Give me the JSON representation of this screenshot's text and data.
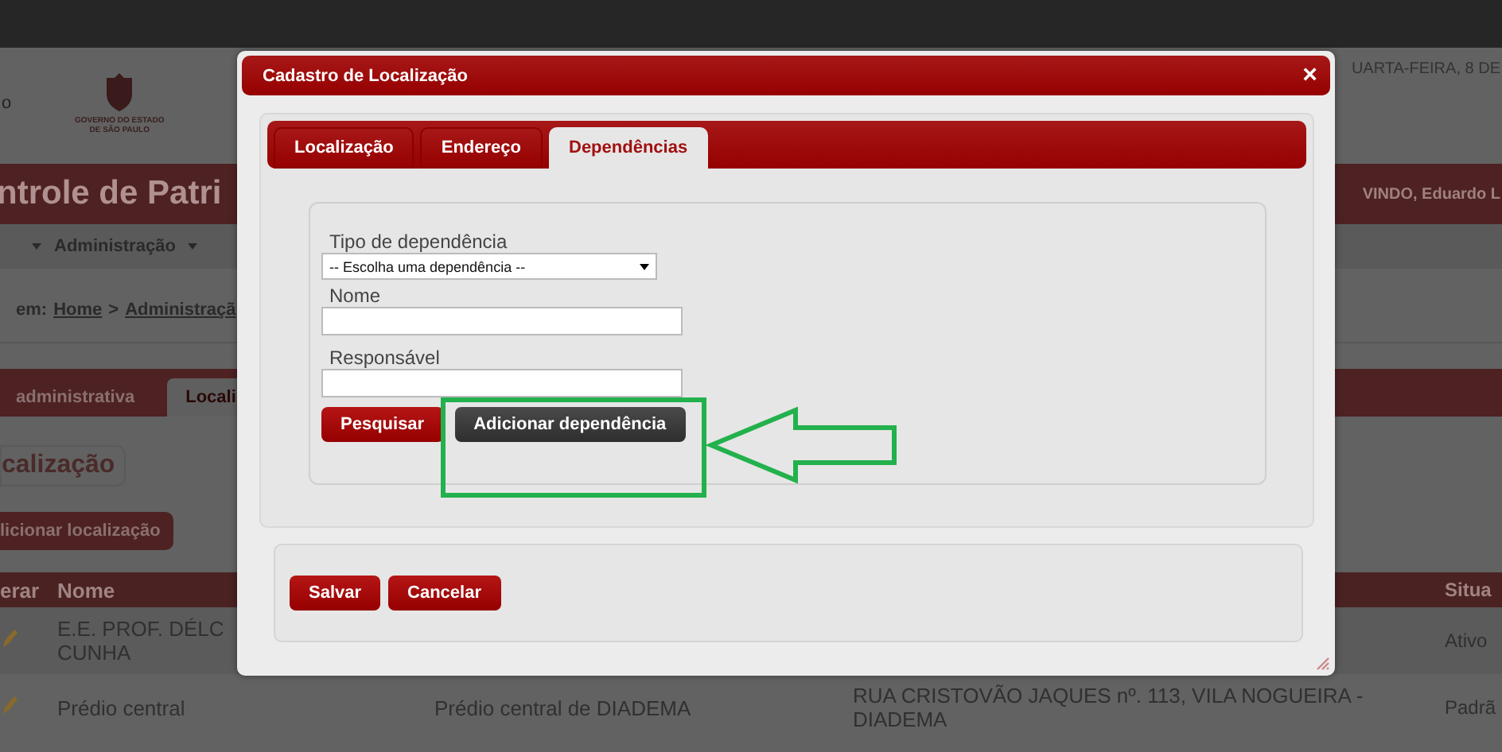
{
  "background": {
    "edge_letter": "o",
    "logo_caption": "GOVERNO DO ESTADO DE SÃO PAULO",
    "date": "UARTA-FEIRA, 8 DE",
    "title": "ntrole de Patri",
    "welcome": "VINDO, Eduardo L",
    "menu": [
      {
        "label": "Administração"
      }
    ],
    "breadcrumb": {
      "prefix": "em:",
      "links": [
        "Home",
        "Administraçã"
      ],
      "separator": ">"
    },
    "tabs": [
      {
        "label": "administrativa",
        "selected": false
      },
      {
        "label": "Locali",
        "selected": true
      }
    ],
    "section_title": "calização",
    "add_button": "licionar localização",
    "table": {
      "columns": [
        "erar",
        "Nome",
        "",
        "",
        "Situa"
      ],
      "rows": [
        {
          "cells": [
            "",
            "E.E. PROF. DÉLC CUNHA",
            "",
            "",
            "Ativo"
          ]
        },
        {
          "cells": [
            "",
            "Prédio central",
            "Prédio central de DIADEMA",
            "RUA CRISTOVÃO JAQUES nº. 113, VILA NOGUEIRA - DIADEMA",
            "Padrã"
          ]
        }
      ]
    }
  },
  "dialog": {
    "title": "Cadastro de Localização",
    "close": "×",
    "tabs": [
      {
        "label": "Localização",
        "selected": false
      },
      {
        "label": "Endereço",
        "selected": false
      },
      {
        "label": "Dependências",
        "selected": true
      }
    ],
    "fields": [
      {
        "kind": "select",
        "label": "Tipo de dependência",
        "value": "-- Escolha uma dependência --"
      },
      {
        "kind": "text",
        "label": "Nome"
      },
      {
        "kind": "text",
        "label": "Responsável"
      }
    ],
    "form_buttons": [
      {
        "label": "Pesquisar",
        "kind": "primary"
      },
      {
        "label": "Adicionar dependência",
        "kind": "dark"
      }
    ],
    "footer_buttons": [
      {
        "label": "Salvar"
      },
      {
        "label": "Cancelar"
      }
    ]
  }
}
